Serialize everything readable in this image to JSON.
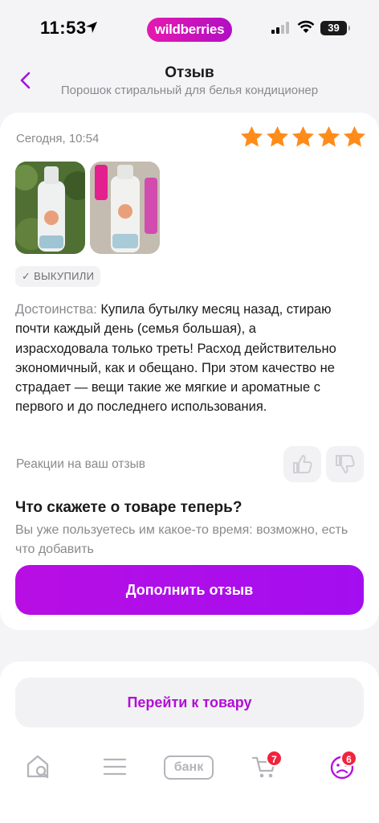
{
  "status_bar": {
    "time": "11:53",
    "brand": "wildberries",
    "battery": "39"
  },
  "header": {
    "title": "Отзыв",
    "subtitle": "Порошок стиральный для белья кондиционер"
  },
  "review": {
    "date": "Сегодня, 10:54",
    "rating": 5,
    "rating_max": 5,
    "badge": "✓ ВЫКУПИЛИ",
    "text_label": "Достоинства:",
    "text": " Купила бутылку месяц назад, стираю почти каждый день (семья большая), а израсходовала только треть! Расход действительно экономичный, как и обещано. При этом качество не страдает — вещи такие же мягкие и ароматные с первого и до последнего использования.",
    "reactions_label": "Реакции на ваш отзыв"
  },
  "update_prompt": {
    "title": "Что скажете о товаре теперь?",
    "text": "Вы уже пользуетесь им какое-то время: возможно, есть что добавить",
    "button": "Дополнить отзыв"
  },
  "product_link": {
    "button": "Перейти к товару"
  },
  "tabbar": {
    "bank_label": "банк",
    "cart_count": "7",
    "profile_count": "6"
  },
  "colors": {
    "accent": "#b50fe6",
    "star": "#ff8c1a",
    "badge": "#f2233d"
  }
}
